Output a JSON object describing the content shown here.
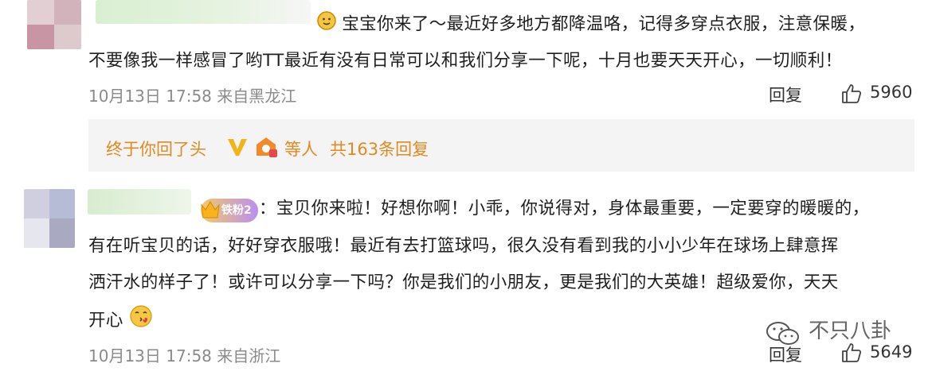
{
  "comment1": {
    "line1": "宝宝你来了～最近好多地方都降温咯，记得多穿点衣服，注意保暖，",
    "line2": "不要像我一样感冒了哟TT最近有没有日常可以和我们分享一下呢，十月也要天天开心，一切顺利！",
    "meta": "10月13日 17:58 来自黑龙江",
    "reply_label": "回复",
    "like_count": "5960",
    "replies": {
      "preview_user": "终于你回了头",
      "tail": "等人",
      "count_text": "共163条回复"
    }
  },
  "comment2": {
    "badge": "铁粉2",
    "line1": "：宝贝你来啦！好想你啊！小乖，你说得对，身体最重要，一定要穿的暖暖的，",
    "line2": "有在听宝贝的话，好好穿衣服哦！最近有去打篮球吗，很久没有看到我的小小少年在球场上肆意挥",
    "line3": "洒汗水的样子了！或许可以分享一下吗？你是我们的小朋友，更是我们的大英雄！超级爱你，天天",
    "line4": "开心",
    "meta": "10月13日 17:58 来自浙江",
    "reply_label": "回复",
    "like_count": "5649"
  },
  "watermark": "不只八卦",
  "colors": {
    "accent_reply": "#e08a1f",
    "meta": "#8a8a8a",
    "reply_bg": "#f4f4f5"
  }
}
